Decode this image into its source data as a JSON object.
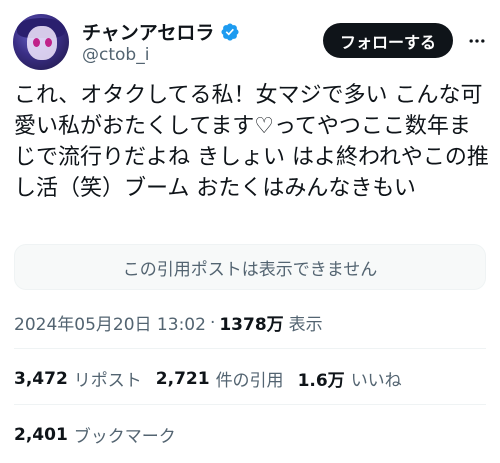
{
  "author": {
    "display_name": "チャンアセロラ",
    "handle": "@ctob_i"
  },
  "actions": {
    "follow_label": "フォローする"
  },
  "tweet": {
    "text": "これ、オタクしてる私！女マジで多い こんな可愛い私がおたくしてます♡ってやつここ数年まじで流行りだよね きしょい はよ終われやこの推し活（笑）ブーム おたくはみんなきもい",
    "quote_unavailable": "この引用ポストは表示できません"
  },
  "meta": {
    "timestamp": "2024年05月20日 13:02",
    "separator": "·",
    "views_count": "1378万",
    "views_label": "表示"
  },
  "stats": {
    "reposts": {
      "count": "3,472",
      "label": "リポスト"
    },
    "quotes": {
      "count": "2,721",
      "label": "件の引用"
    },
    "likes": {
      "count": "1.6万",
      "label": "いいね"
    },
    "bookmarks": {
      "count": "2,401",
      "label": "ブックマーク"
    }
  },
  "icons": {
    "verified": "verified-badge-icon",
    "more": "more-icon"
  },
  "colors": {
    "verified_blue": "#1d9bf0",
    "follow_bg": "#0f1419",
    "secondary_text": "#536471"
  }
}
